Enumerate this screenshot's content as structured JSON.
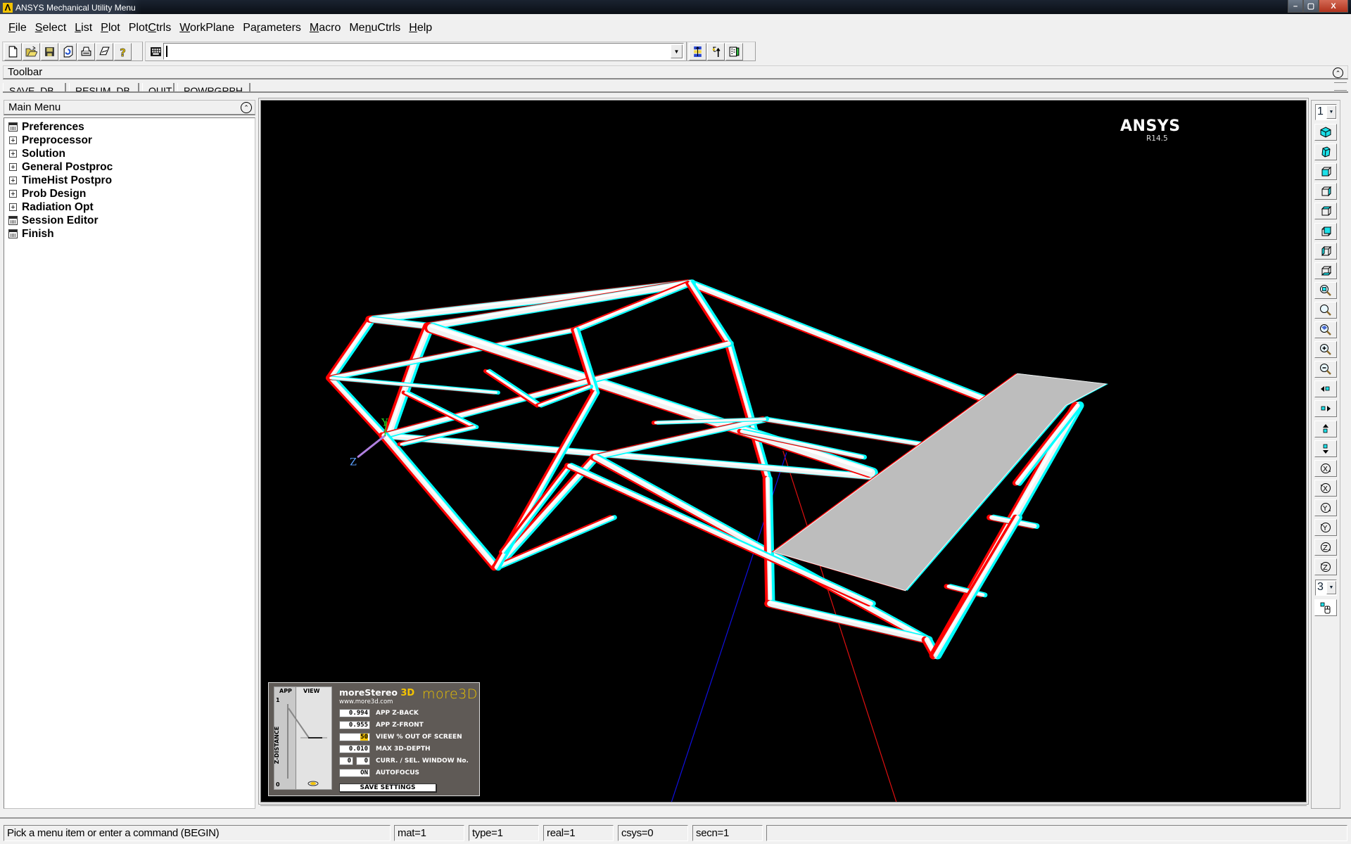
{
  "window": {
    "title": "ANSYS Mechanical Utility Menu",
    "logo_glyph": "Λ",
    "controls": {
      "minimize": "–",
      "maximize": "▢",
      "close": "X"
    }
  },
  "menubar": [
    {
      "label": "File",
      "mnemonic_index": 0
    },
    {
      "label": "Select",
      "mnemonic_index": 0
    },
    {
      "label": "List",
      "mnemonic_index": 0
    },
    {
      "label": "Plot",
      "mnemonic_index": 0
    },
    {
      "label": "PlotCtrls",
      "mnemonic_index": 4
    },
    {
      "label": "WorkPlane",
      "mnemonic_index": 0
    },
    {
      "label": "Parameters",
      "mnemonic_index": 2
    },
    {
      "label": "Macro",
      "mnemonic_index": 0
    },
    {
      "label": "MenuCtrls",
      "mnemonic_index": 2
    },
    {
      "label": "Help",
      "mnemonic_index": 0
    }
  ],
  "toolbar": {
    "file_buttons": [
      "new-file-icon",
      "open-file-icon",
      "save-icon",
      "report-icon",
      "print-icon",
      "image-capture-icon",
      "help-icon"
    ],
    "command_input": {
      "value": "",
      "placeholder": ""
    },
    "command_dropdown_glyph": "▼",
    "right_buttons": [
      "raise-hidden-icon",
      "reset-picking-icon",
      "contact-manager-icon"
    ]
  },
  "toolbar_panel": {
    "label": "Toolbar",
    "collapse_glyph": "⌃",
    "buttons": [
      "SAVE_DB",
      "RESUM_DB",
      "QUIT",
      "POWRGRPH"
    ]
  },
  "main_menu": {
    "title": "Main Menu",
    "collapse_glyph": "⌃",
    "items": [
      {
        "label": "Preferences",
        "type": "dialog"
      },
      {
        "label": "Preprocessor",
        "type": "branch"
      },
      {
        "label": "Solution",
        "type": "branch"
      },
      {
        "label": "General Postproc",
        "type": "branch"
      },
      {
        "label": "TimeHist Postpro",
        "type": "branch"
      },
      {
        "label": "Prob Design",
        "type": "branch"
      },
      {
        "label": "Radiation Opt",
        "type": "branch"
      },
      {
        "label": "Session Editor",
        "type": "dialog"
      },
      {
        "label": "Finish",
        "type": "dialog"
      }
    ]
  },
  "graphics": {
    "brand": "ANSYS",
    "version": "R14.5",
    "background": "#000000",
    "triad": {
      "y_label": "Y",
      "z_label": "Z"
    },
    "stereo_colors": {
      "left": "#ff0000",
      "right": "#00ffff",
      "model": "#f2f2f2",
      "plate": "#bdbdbd"
    }
  },
  "stereo_panel": {
    "title": "moreStereo",
    "title_suffix": "3D",
    "url": "www.more3d.com",
    "brand": "more3D",
    "chart_labels": {
      "app": "APP",
      "view": "VIEW",
      "axis": "Z-DISTANCE",
      "top": "1",
      "bottom": "0"
    },
    "fields": [
      {
        "value": "0.994",
        "label": "APP Z-BACK"
      },
      {
        "value": "0.955",
        "label": "APP Z-FRONT"
      },
      {
        "value": "50",
        "label": "VIEW % OUT OF SCREEN",
        "highlight": true
      },
      {
        "value": "0.010",
        "label": "MAX 3D-DEPTH"
      },
      {
        "value": "0",
        "value2": "0",
        "label": "CURR. / SEL. WINDOW No."
      },
      {
        "value": "ON",
        "label": "AUTOFOCUS"
      }
    ],
    "save_label": "SAVE SETTINGS"
  },
  "right_toolbar": {
    "window_select": "1",
    "window_count_select": "3",
    "buttons": [
      "isometric-view-icon",
      "oblique-view-icon",
      "front-view-icon",
      "right-view-icon",
      "top-view-icon",
      "back-view-icon",
      "left-view-icon",
      "bottom-view-icon",
      "fit-view-icon",
      "zoom-icon",
      "zoom-back-icon",
      "zoom-in-icon",
      "zoom-out-icon",
      "pan-left-icon",
      "pan-right-icon",
      "pan-up-icon",
      "pan-down-icon",
      "rotate-x-pos-icon",
      "rotate-x-neg-icon",
      "rotate-y-pos-icon",
      "rotate-y-neg-icon",
      "rotate-z-pos-icon",
      "rotate-z-neg-icon"
    ],
    "dynamic_mode_icon": "dynamic-mode-icon"
  },
  "status_bar": {
    "prompt": "Pick a menu item or enter a command (BEGIN)",
    "mat": "mat=1",
    "type": "type=1",
    "real": "real=1",
    "csys": "csys=0",
    "secn": "secn=1",
    "extra": ""
  }
}
